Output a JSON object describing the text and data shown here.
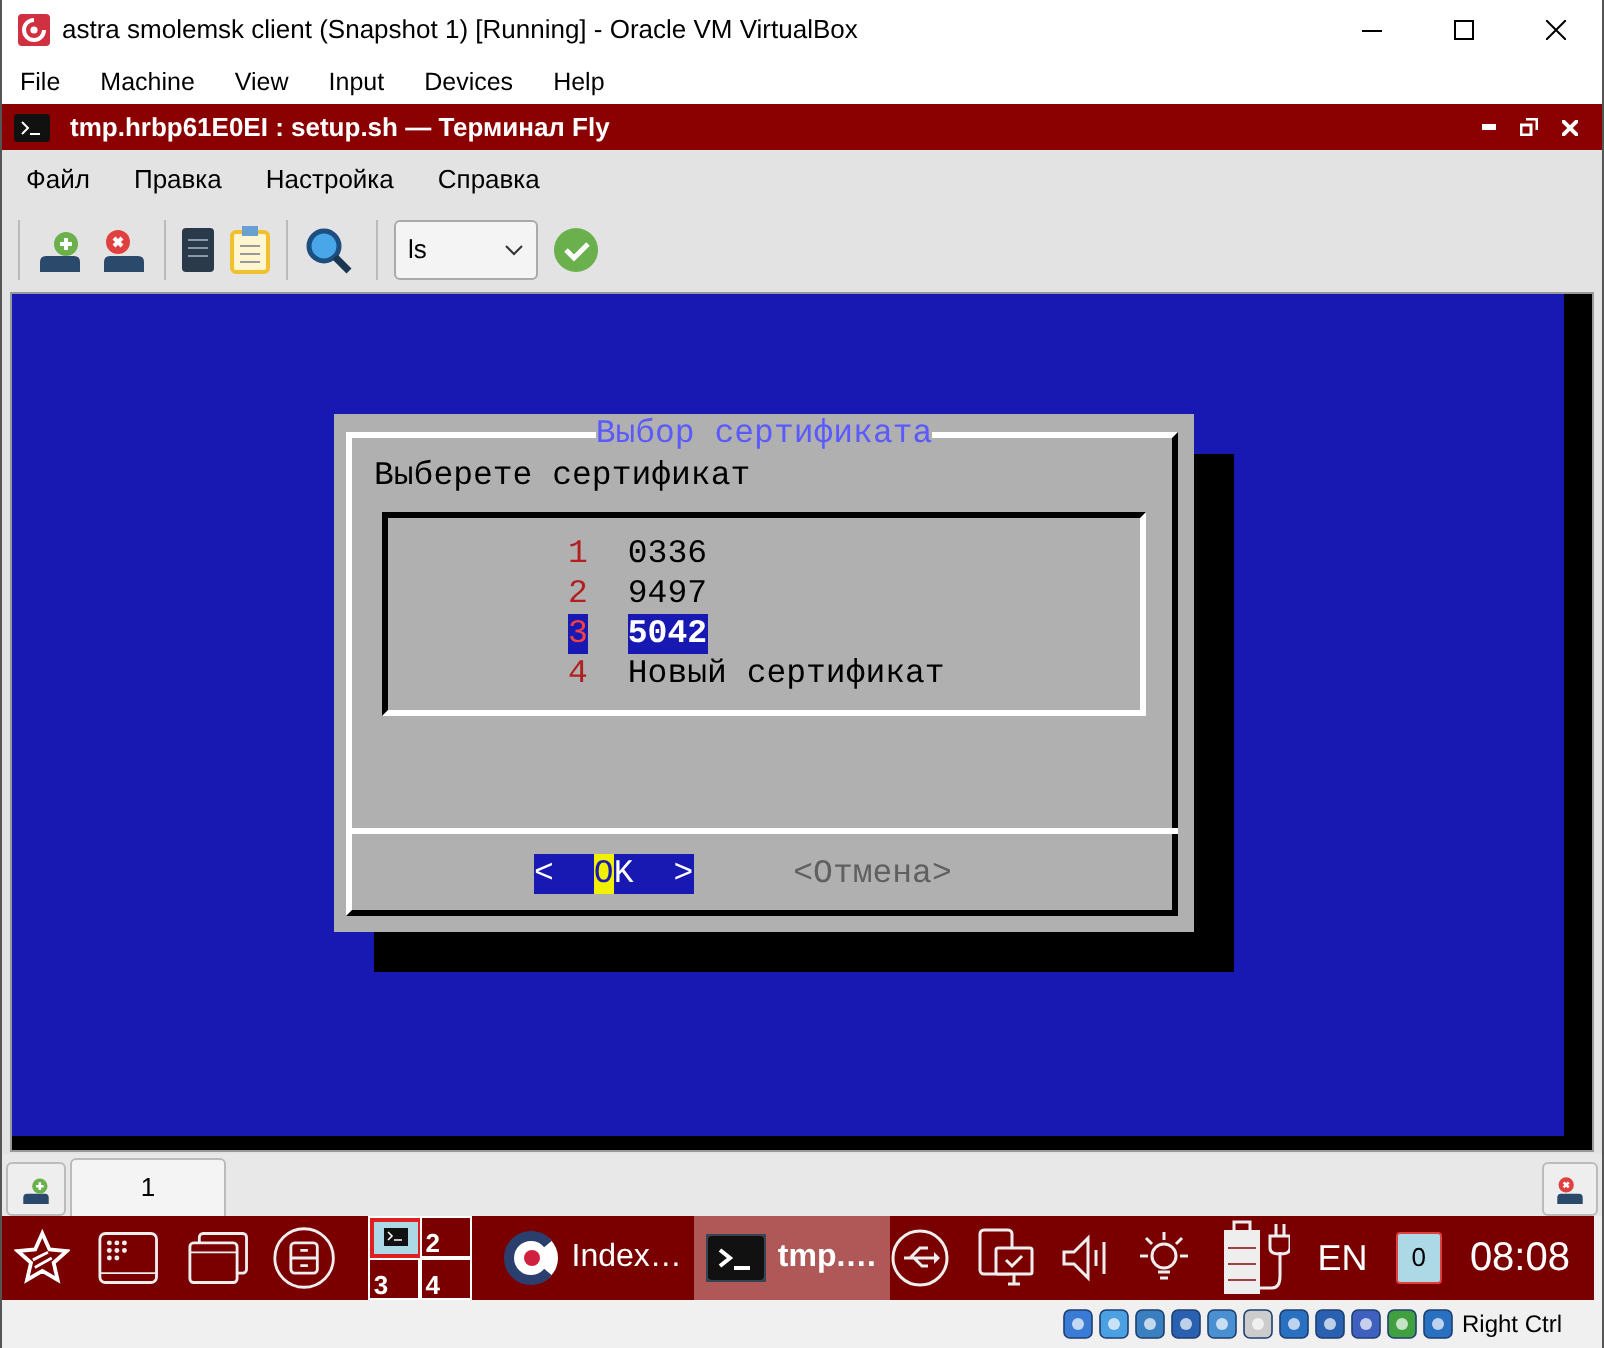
{
  "vbox": {
    "title": "astra smolemsk client (Snapshot 1) [Running] - Oracle VM VirtualBox",
    "menu": [
      "File",
      "Machine",
      "View",
      "Input",
      "Devices",
      "Help"
    ],
    "host_key": "Right Ctrl"
  },
  "terminal_window": {
    "title": "tmp.hrbp61E0EI : setup.sh — Терминал Fly",
    "menu": [
      "Файл",
      "Правка",
      "Настройка",
      "Справка"
    ],
    "command_combo": "ls"
  },
  "dialog": {
    "title": "Выбор сертификата",
    "prompt": "Выберете сертификат",
    "items": [
      {
        "number": "1",
        "label": "0336",
        "selected": false
      },
      {
        "number": "2",
        "label": "9497",
        "selected": false
      },
      {
        "number": "3",
        "label": "5042",
        "selected": true
      },
      {
        "number": "4",
        "label": "Новый сертификат",
        "selected": false
      }
    ],
    "buttons": [
      {
        "left": "<",
        "label": "OK",
        "right": ">",
        "selected": true
      },
      {
        "left": "<",
        "label": "Отмена",
        "right": ">",
        "selected": false
      }
    ]
  },
  "tabs": [
    {
      "label": "1",
      "selected": true
    }
  ],
  "taskbar": {
    "desktops": [
      {
        "selected": true
      },
      {
        "label": "2",
        "selected": false
      },
      {
        "label": "3",
        "selected": false
      },
      {
        "label": "4",
        "selected": false
      }
    ],
    "tasks": [
      {
        "label": "Index…",
        "selected": false
      },
      {
        "label": "tmp.…",
        "selected": true
      }
    ],
    "language": "EN",
    "notifications": "0",
    "clock": "08:08"
  }
}
